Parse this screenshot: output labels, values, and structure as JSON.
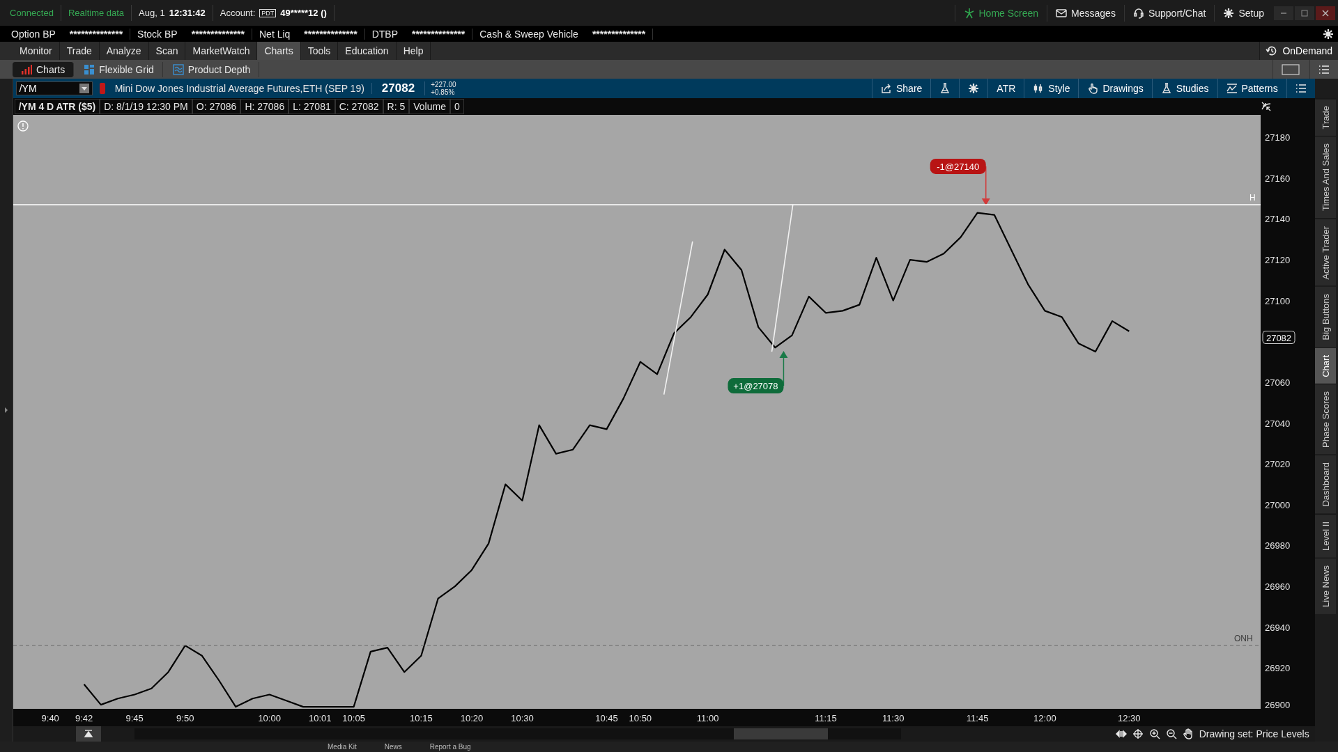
{
  "status_bar": {
    "items": [
      {
        "text": "Connected",
        "kind": "ok"
      },
      {
        "text": "Realtime data",
        "kind": "ok"
      }
    ],
    "date": "Aug, 1",
    "time": "12:31:42",
    "account_label": "Account:",
    "account_badge": "PDT",
    "account": "49*****12 ()"
  },
  "top_links": [
    {
      "label": "Home Screen",
      "kind": "home"
    },
    {
      "label": "Messages",
      "kind": "mail"
    },
    {
      "label": "Support/Chat",
      "kind": "support"
    },
    {
      "label": "Setup",
      "kind": "setup"
    }
  ],
  "balances": [
    {
      "label": "Option BP",
      "value": "**************"
    },
    {
      "label": "Stock BP",
      "value": "**************"
    },
    {
      "label": "Net Liq",
      "value": "**************"
    },
    {
      "label": "DTBP",
      "value": "**************"
    },
    {
      "label": "Cash & Sweep Vehicle",
      "value": "**************"
    }
  ],
  "main_tabs": [
    {
      "label": "Monitor",
      "selected": false
    },
    {
      "label": "Trade",
      "selected": false
    },
    {
      "label": "Analyze",
      "selected": false
    },
    {
      "label": "Scan",
      "selected": false
    },
    {
      "label": "MarketWatch",
      "selected": false
    },
    {
      "label": "Charts",
      "selected": true
    },
    {
      "label": "Tools",
      "selected": false
    },
    {
      "label": "Education",
      "selected": false
    },
    {
      "label": "Help",
      "selected": false
    }
  ],
  "on_demand": "OnDemand",
  "sub_tabs": [
    {
      "label": "Charts",
      "selected": true,
      "kind": "bars"
    },
    {
      "label": "Flexible Grid",
      "selected": false,
      "kind": "grid"
    },
    {
      "label": "Product Depth",
      "selected": false,
      "kind": "depth"
    }
  ],
  "symbol_bar": {
    "symbol": "/YM",
    "description": "Mini Dow Jones Industrial Average Futures,ETH (SEP 19)",
    "last": "27082",
    "change": "+227.00",
    "change_pct": "+0.85%",
    "tools": [
      {
        "kind": "share",
        "label": "Share"
      },
      {
        "kind": "flask"
      },
      {
        "kind": "gear"
      },
      {
        "kind": "text",
        "label": "ATR"
      },
      {
        "kind": "style",
        "label": "Style"
      },
      {
        "kind": "drawings",
        "label": "Drawings"
      },
      {
        "kind": "studies",
        "label": "Studies"
      },
      {
        "kind": "patterns",
        "label": "Patterns"
      },
      {
        "kind": "menu"
      }
    ]
  },
  "chart_header": {
    "title": "/YM 4 D ATR ($5)",
    "fields": [
      "D: 8/1/19 12:30 PM",
      "O: 27086",
      "H: 27086",
      "L: 27081",
      "C: 27082",
      "R: 5",
      "Volume",
      "0"
    ]
  },
  "chart": {
    "last_price": "27082",
    "chart_data": {
      "type": "line",
      "ylim": [
        26900,
        27191
      ],
      "yticks": [
        26900,
        26920,
        26940,
        26960,
        26980,
        27000,
        27020,
        27040,
        27060,
        27100,
        27120,
        27140,
        27160,
        27180
      ],
      "categories": [
        null,
        null,
        "9:40",
        null,
        "9:42",
        null,
        null,
        "9:45",
        null,
        null,
        "9:50",
        null,
        null,
        null,
        null,
        "10:00",
        null,
        null,
        "10:01",
        null,
        "10:05",
        null,
        null,
        null,
        "10:15",
        null,
        null,
        "10:20",
        null,
        null,
        "10:30",
        null,
        null,
        null,
        null,
        "10:45",
        null,
        "10:50",
        null,
        null,
        null,
        "11:00",
        null,
        null,
        null,
        null,
        null,
        null,
        "11:15",
        null,
        null,
        null,
        "11:30",
        null,
        null,
        null,
        null,
        "11:45",
        null,
        null,
        null,
        "12:00",
        null,
        null,
        null,
        null,
        "12:30",
        null,
        null,
        null,
        null,
        null,
        null,
        null
      ],
      "values": [
        null,
        null,
        null,
        null,
        26912,
        26902,
        26905,
        26907,
        26910,
        26918,
        26931,
        26926,
        26914,
        26901,
        26905,
        26907,
        26904,
        26901,
        null,
        null,
        26901,
        26928,
        26930,
        26918,
        26926,
        26954,
        26960,
        26968,
        26981,
        27010,
        27002,
        27039,
        27025,
        27027,
        27039,
        27037,
        27052,
        27070,
        27064,
        27084,
        27092,
        27103,
        27125,
        27115,
        27087,
        27077,
        27083,
        27102,
        27094,
        27095,
        27098,
        27121,
        27100,
        27120,
        27119,
        27123,
        27131,
        27143,
        27142,
        27125,
        27108,
        27095,
        27092,
        27079,
        27075,
        27090,
        27085,
        null,
        null,
        null,
        null,
        null,
        null,
        null
      ],
      "annotations": [
        "-1@27140",
        "+1@27078"
      ]
    },
    "level_labels": [
      "H",
      "ONH"
    ]
  },
  "chart_footer": {
    "drawing_set": "Drawing set: Price Levels"
  },
  "side_tabs": [
    {
      "label": "Trade",
      "selected": false
    },
    {
      "label": "Times And Sales",
      "selected": false
    },
    {
      "label": "Active Trader",
      "selected": false
    },
    {
      "label": "Big Buttons",
      "selected": false
    },
    {
      "label": "Chart",
      "selected": true
    },
    {
      "label": "Phase Scores",
      "selected": false
    },
    {
      "label": "Dashboard",
      "selected": false
    },
    {
      "label": "Level II",
      "selected": false
    },
    {
      "label": "Live News",
      "selected": false
    }
  ],
  "footer_links": [
    "Media Kit",
    "News",
    "Report a Bug"
  ]
}
